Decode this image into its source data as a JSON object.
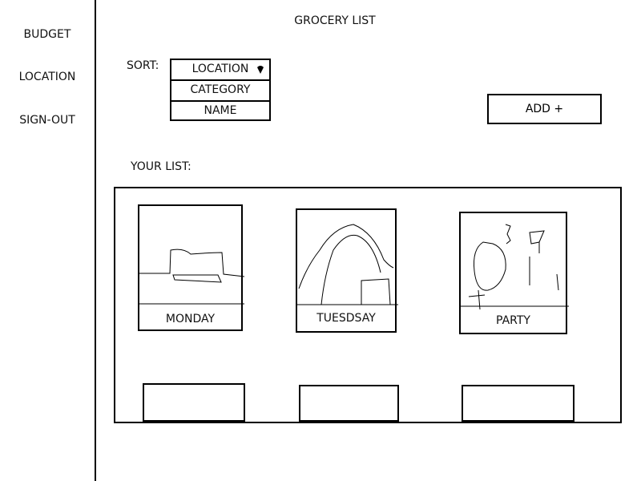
{
  "sidebar": {
    "items": [
      {
        "label": "BUDGET"
      },
      {
        "label": "LOCATION"
      },
      {
        "label": "SIGN-OUT"
      }
    ]
  },
  "header": {
    "title": "GROCERY LIST"
  },
  "sort": {
    "label": "SORT:",
    "selected": "LOCATION",
    "options": [
      "CATEGORY",
      "NAME"
    ]
  },
  "actions": {
    "add_label": "ADD +"
  },
  "list": {
    "heading": "YOUR LIST:",
    "cards": [
      {
        "label": "MONDAY"
      },
      {
        "label": "TUESDSAY"
      },
      {
        "label": "PARTY"
      }
    ]
  }
}
